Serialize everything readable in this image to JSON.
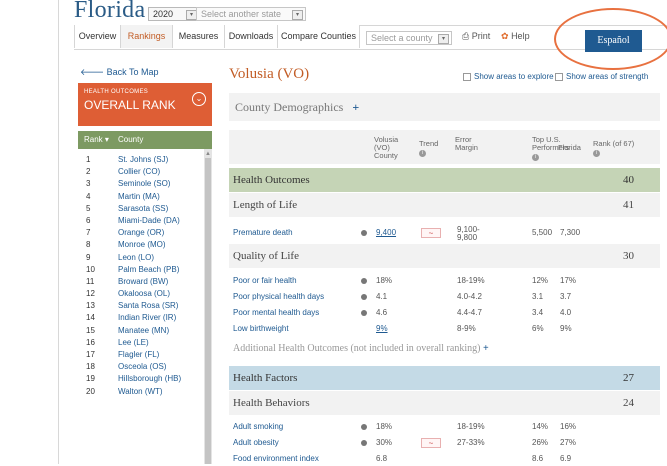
{
  "header": {
    "state_title": "Florida",
    "year": "2020",
    "state_select_placeholder": "Select another state"
  },
  "tabs": [
    "Overview",
    "Rankings",
    "Measures",
    "Downloads",
    "Compare Counties"
  ],
  "toolbar": {
    "county_select_placeholder": "Select a county",
    "print_label": "Print",
    "help_label": "Help",
    "espanol_label": "Español"
  },
  "sidebar": {
    "back_label": "Back To Map",
    "card_sub": "HEALTH OUTCOMES",
    "card_title": "OVERALL RANK",
    "rank_header": "Rank",
    "county_header": "County",
    "rows": [
      {
        "rank": "1",
        "county": "St. Johns (SJ)"
      },
      {
        "rank": "2",
        "county": "Collier (CO)"
      },
      {
        "rank": "3",
        "county": "Seminole (SO)"
      },
      {
        "rank": "4",
        "county": "Martin (MA)"
      },
      {
        "rank": "5",
        "county": "Sarasota (SS)"
      },
      {
        "rank": "6",
        "county": "Miami-Dade (DA)"
      },
      {
        "rank": "7",
        "county": "Orange (OR)"
      },
      {
        "rank": "8",
        "county": "Monroe (MO)"
      },
      {
        "rank": "9",
        "county": "Leon (LO)"
      },
      {
        "rank": "10",
        "county": "Palm Beach (PB)"
      },
      {
        "rank": "11",
        "county": "Broward (BW)"
      },
      {
        "rank": "12",
        "county": "Okaloosa (OL)"
      },
      {
        "rank": "13",
        "county": "Santa Rosa (SR)"
      },
      {
        "rank": "14",
        "county": "Indian River (IR)"
      },
      {
        "rank": "15",
        "county": "Manatee (MN)"
      },
      {
        "rank": "16",
        "county": "Lee (LE)"
      },
      {
        "rank": "17",
        "county": "Flagler (FL)"
      },
      {
        "rank": "18",
        "county": "Osceola (OS)"
      },
      {
        "rank": "19",
        "county": "Hillsborough (HB)"
      },
      {
        "rank": "20",
        "county": "Walton (WT)"
      }
    ]
  },
  "main": {
    "county_title": "Volusia (VO)",
    "show_explore": "Show areas to explore",
    "show_strength": "Show areas of strength",
    "demographics": "County Demographics",
    "plus": "+",
    "columns": {
      "county": [
        "Volusia",
        "(VO)",
        "County"
      ],
      "trend": "Trend",
      "error": [
        "Error",
        "Margin"
      ],
      "top": [
        "Top U.S.",
        "Performers"
      ],
      "florida": "Florida",
      "rank": [
        "Rank (of 67)"
      ]
    },
    "health_outcomes": {
      "label": "Health Outcomes",
      "rank": "40"
    },
    "length_of_life": {
      "label": "Length of Life",
      "rank": "41"
    },
    "premature_death": {
      "name": "Premature death",
      "value": "9,400",
      "error": [
        "9,100-",
        "9,800"
      ],
      "top": "5,500",
      "florida": "7,300"
    },
    "quality_of_life": {
      "label": "Quality of Life",
      "rank": "30"
    },
    "qol_rows": [
      {
        "name": "Poor or fair health",
        "value": "18%",
        "error": "18-19%",
        "top": "12%",
        "florida": "17%"
      },
      {
        "name": "Poor physical health days",
        "value": "4.1",
        "error": "4.0-4.2",
        "top": "3.1",
        "florida": "3.7"
      },
      {
        "name": "Poor mental health days",
        "value": "4.6",
        "error": "4.4-4.7",
        "top": "3.4",
        "florida": "4.0"
      },
      {
        "name": "Low birthweight",
        "value": "9%",
        "error": "8-9%",
        "top": "6%",
        "florida": "9%"
      }
    ],
    "additional": "Additional Health Outcomes (not included in overall ranking)",
    "health_factors": {
      "label": "Health Factors",
      "rank": "27"
    },
    "health_behaviors": {
      "label": "Health Behaviors",
      "rank": "24"
    },
    "hb_rows": [
      {
        "name": "Adult smoking",
        "value": "18%",
        "error": "18-19%",
        "top": "14%",
        "florida": "16%"
      },
      {
        "name": "Adult obesity",
        "value": "30%",
        "error": "27-33%",
        "top": "26%",
        "florida": "27%"
      },
      {
        "name": "Food environment index",
        "value": "6.8",
        "error": "",
        "top": "8.6",
        "florida": "6.9"
      }
    ],
    "trend_glyph": "~",
    "check_glyph": ""
  }
}
